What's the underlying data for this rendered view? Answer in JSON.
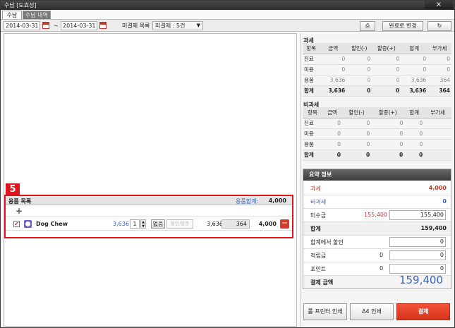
{
  "window": {
    "title": "수납 [도효성]",
    "close_label": "×"
  },
  "tabs": [
    {
      "label": "수납"
    },
    {
      "label": "수납 내역"
    }
  ],
  "toolbar": {
    "date_from": "2014-03-31",
    "date_sep": "~",
    "date_to": "2014-03-31",
    "unpaid_label": "미결제 목록",
    "unpaid_select": "미결제 : 5건",
    "save_icon": "⎙",
    "change_complete": "완료로 변경",
    "refresh_icon": "↻"
  },
  "taxable": {
    "title": "과세",
    "headers": [
      "항목",
      "금액",
      "할인(-)",
      "할증(+)",
      "합계",
      "부가세"
    ],
    "rows": [
      [
        "진료",
        "0",
        "0",
        "0",
        "0",
        "0"
      ],
      [
        "미용",
        "0",
        "0",
        "0",
        "0",
        "0"
      ],
      [
        "용품",
        "3,636",
        "0",
        "0",
        "3,636",
        "364"
      ]
    ],
    "total": [
      "합계",
      "3,636",
      "0",
      "0",
      "3,636",
      "364"
    ]
  },
  "nontaxable": {
    "title": "비과세",
    "headers": [
      "항목",
      "금액",
      "할인(-)",
      "할증(+)",
      "합계",
      "부가세"
    ],
    "rows": [
      [
        "진료",
        "0",
        "0",
        "0",
        "0",
        ""
      ],
      [
        "미용",
        "0",
        "0",
        "0",
        "0",
        ""
      ],
      [
        "용품",
        "0",
        "0",
        "0",
        "0",
        ""
      ]
    ],
    "total": [
      "합계",
      "0",
      "0",
      "0",
      "0",
      ""
    ]
  },
  "summary": {
    "title": "요약 정보",
    "taxable_label": "과세",
    "taxable_value": "4,000",
    "nontaxable_label": "비과세",
    "nontaxable_value": "0",
    "unpaid_label": "미수금",
    "unpaid_value": "155,400",
    "unpaid_input": "155,400",
    "total_label": "합계",
    "total_value": "159,400",
    "discount_label": "합계에서 할인",
    "discount_input": "0",
    "reserve_label": "적립금",
    "reserve_value": "0",
    "reserve_input": "0",
    "point_label": "포인트",
    "point_value": "0",
    "point_input": "0",
    "pay_amount_label": "결제 금액",
    "pay_amount_value": "159,400"
  },
  "buttons": {
    "roll_print": "롤 프린터 인쇄",
    "a4_print": "A4 인쇄",
    "pay": "결제"
  },
  "items": {
    "badge": "5",
    "title": "용품 목록",
    "sum_label": "용품합계:",
    "sum_value": "4,000",
    "add_icon": "+",
    "rows": [
      {
        "check": "✔",
        "name": "Dog Chew",
        "price": "3,636",
        "qty": "1",
        "round_label": "없음",
        "discount_placeholder": "할인/할증",
        "amount": "3,636",
        "vat": "364",
        "total": "4,000",
        "delete_icon": "−"
      }
    ]
  },
  "colors": {
    "accent_red": "#e0151b",
    "blue": "#3a63b8",
    "pay_button": "#e0412a"
  }
}
